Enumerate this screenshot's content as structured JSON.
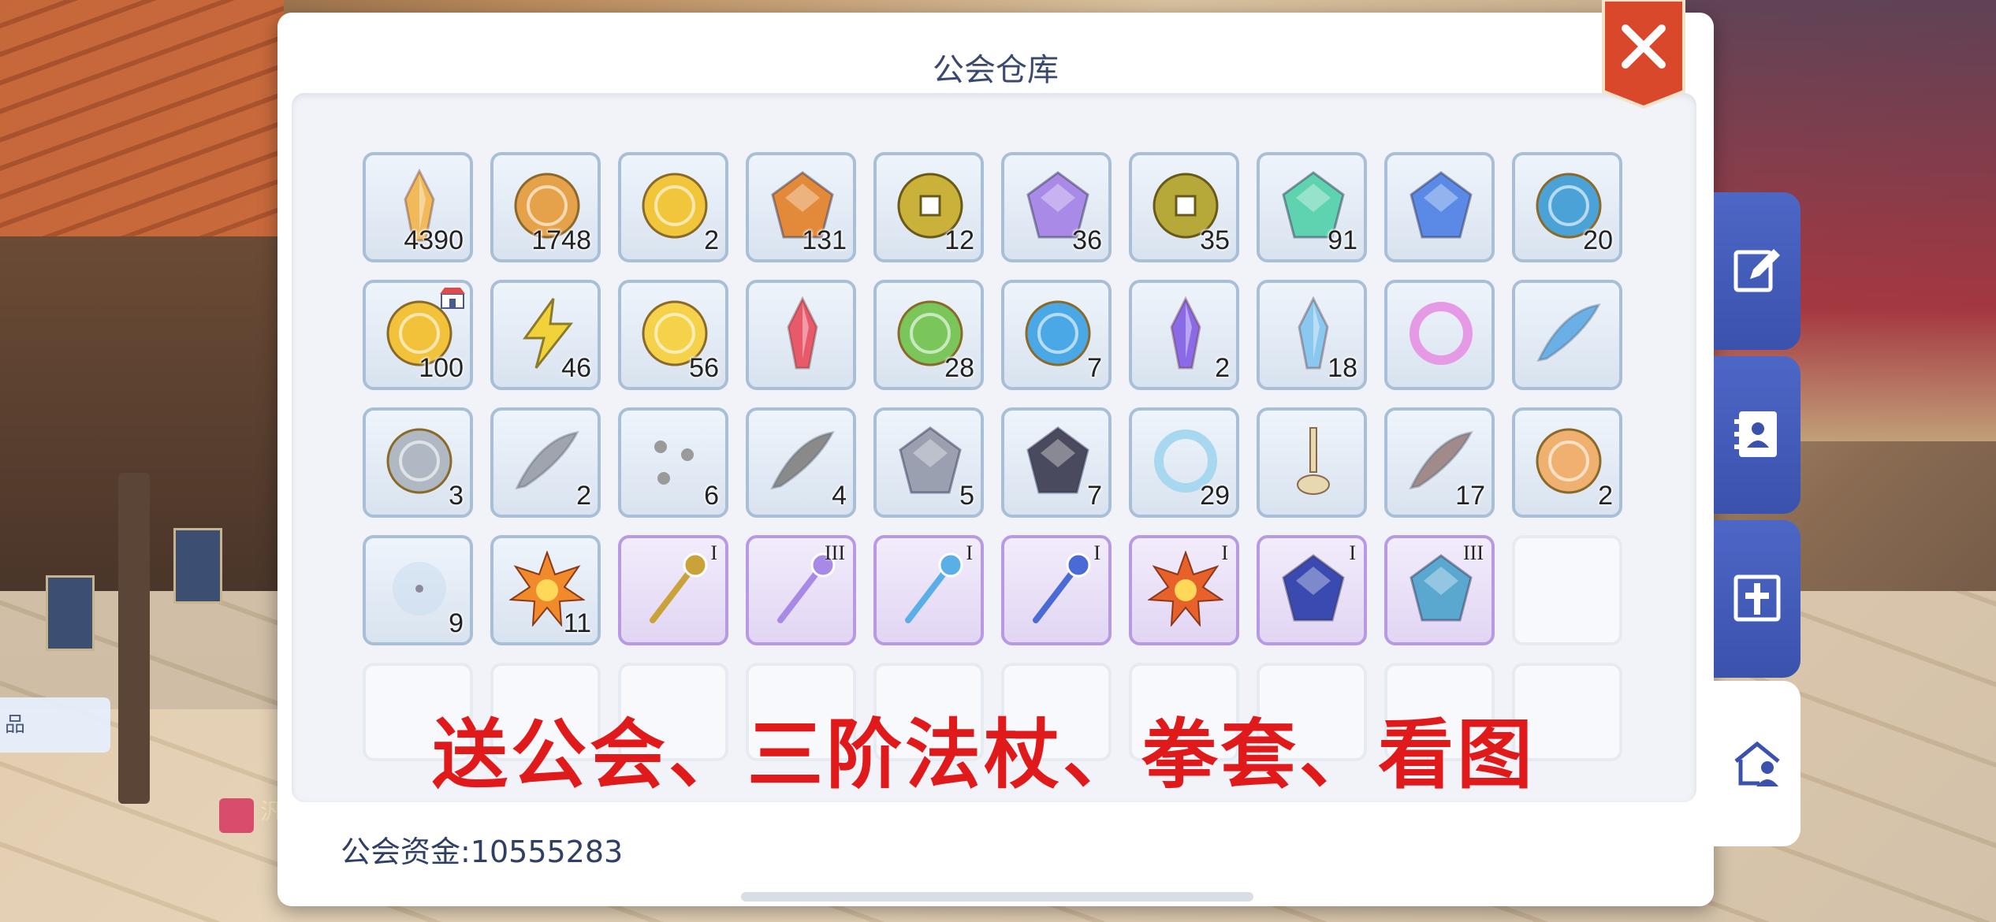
{
  "window": {
    "title": "公会仓库"
  },
  "funds": {
    "label": "公会资金:10555283"
  },
  "overlay": {
    "text": "送公会、三阶法杖、拳套、看图"
  },
  "side_hint": {
    "text": "品"
  },
  "chat": {
    "text": "汎"
  },
  "colors": {
    "tab_blue": "#4d67c6",
    "close_red": "#d9482b",
    "overlay_red": "#e0191b"
  },
  "items": [
    {
      "name": "crystal-shard",
      "qty": "4390",
      "color": "#f0b95a",
      "shape": "crystal"
    },
    {
      "name": "coin-face",
      "qty": "1748",
      "color": "#e6a24a",
      "shape": "coin"
    },
    {
      "name": "gold-coin",
      "qty": "2",
      "color": "#f2c63a",
      "shape": "coin"
    },
    {
      "name": "amber-stone",
      "qty": "131",
      "color": "#e28a3a",
      "shape": "gem"
    },
    {
      "name": "gold-square-coin",
      "qty": "12",
      "color": "#c9b13a",
      "shape": "square"
    },
    {
      "name": "purple-medal",
      "qty": "36",
      "color": "#a98ae6",
      "shape": "gem"
    },
    {
      "name": "gold-square-coin-2",
      "qty": "35",
      "color": "#b7a83a",
      "shape": "square"
    },
    {
      "name": "green-gem",
      "qty": "91",
      "color": "#5fd3b0",
      "shape": "gem"
    },
    {
      "name": "blue-rune-stone",
      "qty": "",
      "color": "#5a8ae6",
      "shape": "gem"
    },
    {
      "name": "swirl-orb",
      "qty": "20",
      "color": "#4aa2d6",
      "shape": "coin"
    },
    {
      "name": "gold-token",
      "qty": "100",
      "color": "#f2c33a",
      "shape": "coin",
      "badge": true
    },
    {
      "name": "lightning-crystal",
      "qty": "46",
      "color": "#f2d23a",
      "shape": "bolt"
    },
    {
      "name": "golden-shell",
      "qty": "56",
      "color": "#f5d24a",
      "shape": "coin"
    },
    {
      "name": "red-crystal",
      "qty": "",
      "color": "#e85a6a",
      "shape": "crystal"
    },
    {
      "name": "green-core",
      "qty": "28",
      "color": "#7ac65a",
      "shape": "coin"
    },
    {
      "name": "blue-orb",
      "qty": "7",
      "color": "#4aa8e6",
      "shape": "coin"
    },
    {
      "name": "purple-crystal",
      "qty": "2",
      "color": "#8a6ae6",
      "shape": "crystal"
    },
    {
      "name": "ice-shard",
      "qty": "18",
      "color": "#8ac8f0",
      "shape": "crystal"
    },
    {
      "name": "pink-ring",
      "qty": "",
      "color": "#e69ae6",
      "shape": "ring"
    },
    {
      "name": "feather",
      "qty": "",
      "color": "#6ab0e6",
      "shape": "feather"
    },
    {
      "name": "crystal-ball",
      "qty": "3",
      "color": "#b0b8c4",
      "shape": "coin"
    },
    {
      "name": "smoke-wisp",
      "qty": "2",
      "color": "#a0a4ac",
      "shape": "feather"
    },
    {
      "name": "paw-prints",
      "qty": "6",
      "color": "#9a9a9a",
      "shape": "paws"
    },
    {
      "name": "claw-marks",
      "qty": "4",
      "color": "#8a8a8a",
      "shape": "feather"
    },
    {
      "name": "steel-gauntlet",
      "qty": "5",
      "color": "#9aa0b0",
      "shape": "gem"
    },
    {
      "name": "dark-armor",
      "qty": "7",
      "color": "#4a4a5e",
      "shape": "gem"
    },
    {
      "name": "water-fish",
      "qty": "29",
      "color": "#a8d8f0",
      "shape": "ring"
    },
    {
      "name": "flask",
      "qty": "",
      "color": "#e8d8b0",
      "shape": "flask"
    },
    {
      "name": "branch",
      "qty": "17",
      "color": "#a08a8a",
      "shape": "feather"
    },
    {
      "name": "amber-orb",
      "qty": "2",
      "color": "#f0b070",
      "shape": "coin"
    },
    {
      "name": "faint-dust",
      "qty": "9",
      "color": "#c8dcf0",
      "shape": "dot"
    },
    {
      "name": "sun-emblem",
      "qty": "11",
      "color": "#f08a2a",
      "shape": "sun"
    },
    {
      "name": "gold-staff",
      "qty": "",
      "tier": "I",
      "color": "#c9a23a",
      "shape": "staff",
      "purple": true
    },
    {
      "name": "star-staff",
      "qty": "",
      "tier": "III",
      "color": "#a88ae6",
      "shape": "staff",
      "purple": true
    },
    {
      "name": "wing-staff",
      "qty": "",
      "tier": "I",
      "color": "#5ab0e6",
      "shape": "staff",
      "purple": true
    },
    {
      "name": "blue-axe-staff",
      "qty": "",
      "tier": "I",
      "color": "#4a6ad6",
      "shape": "staff",
      "purple": true
    },
    {
      "name": "flame-gauntlet",
      "qty": "",
      "tier": "I",
      "color": "#e8602a",
      "shape": "sun",
      "purple": true
    },
    {
      "name": "moon-lyre",
      "qty": "",
      "tier": "I",
      "color": "#3a4ab0",
      "shape": "gem",
      "purple": true
    },
    {
      "name": "claw-gauntlet",
      "qty": "",
      "tier": "III",
      "color": "#5aa8d0",
      "shape": "gem",
      "purple": true
    },
    {
      "name": "empty",
      "qty": "",
      "color": "",
      "shape": "empty"
    }
  ],
  "empty_row_count": 10,
  "tabs": [
    {
      "name": "tab-edit",
      "icon": "edit-icon"
    },
    {
      "name": "tab-contacts",
      "icon": "contacts-icon"
    },
    {
      "name": "tab-church",
      "icon": "cross-icon"
    },
    {
      "name": "tab-guild-home",
      "icon": "home-person-icon",
      "active": true
    }
  ]
}
